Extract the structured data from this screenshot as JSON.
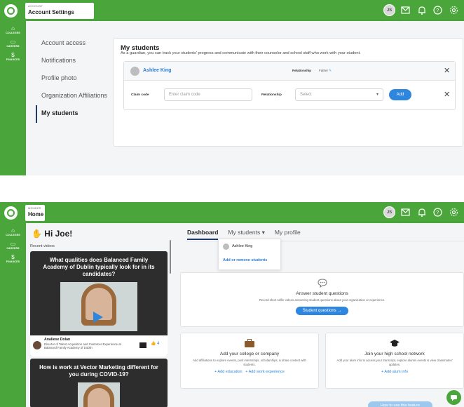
{
  "screen1": {
    "header": {
      "breadcrumb_small": "ACCOUNT",
      "breadcrumb_title": "Account Settings",
      "avatar_initials": "JS"
    },
    "sidebar": [
      {
        "label": "COLLEGES",
        "icon": "building-icon"
      },
      {
        "label": "CAREERS",
        "icon": "briefcase-icon"
      },
      {
        "label": "FINANCES",
        "icon": "money-icon"
      }
    ],
    "nav": [
      "Account access",
      "Notifications",
      "Profile photo",
      "Organization Affiliations",
      "My students"
    ],
    "students": {
      "title": "My students",
      "subtitle": "As a guardian, you can track your students' progress and communicate with their counselor and school staff who work with your student.",
      "student_name": "Ashlee King",
      "relationship_label": "Relationship",
      "relationship_value": "Father",
      "claim_label": "Claim code",
      "claim_placeholder": "Enter claim code",
      "relationship2_label": "Relationship",
      "select_placeholder": "Select",
      "add_label": "Add"
    }
  },
  "screen2": {
    "header": {
      "breadcrumb_small": "MEMBER",
      "breadcrumb_title": "Home",
      "avatar_initials": "JS"
    },
    "sidebar": [
      {
        "label": "COLLEGES",
        "icon": "building-icon"
      },
      {
        "label": "CAREERS",
        "icon": "briefcase-icon"
      },
      {
        "label": "FINANCES",
        "icon": "money-icon"
      }
    ],
    "greeting": "Hi Joe!",
    "tabs": [
      "Dashboard",
      "My students ▾",
      "My profile"
    ],
    "dropdown": [
      "Ashlee King",
      "Add or remove students"
    ],
    "recent_label": "Recent videos",
    "videos": [
      {
        "question": "What qualities does Balanced Family Academy of Dublin typically look for in its candidates?",
        "name": "Analiese Dolan",
        "role": "Director of Talent Acquisition and Customer Experience at Balanced Family Academy of Dublin",
        "likes": "4"
      },
      {
        "question": "How is work at Vector Marketing different for you during COVID-19?"
      }
    ],
    "answer_panel": {
      "title": "Answer student questions",
      "desc": "Record short selfie videos answering student questions about your organization or experience.",
      "button": "Student questions →"
    },
    "college_panel": {
      "title": "Add your college or company",
      "desc": "Add affiliations to explore events, post internships, scholarships, & share content with students.",
      "link1": "+ Add education",
      "link2": "+ Add work experience"
    },
    "network_panel": {
      "title": "Join your high school network",
      "desc": "Add your alum info to access your transcript, explore alumni events & view classmates' updates.",
      "link": "+ Add alum info"
    },
    "howto": "How to use this feature"
  }
}
